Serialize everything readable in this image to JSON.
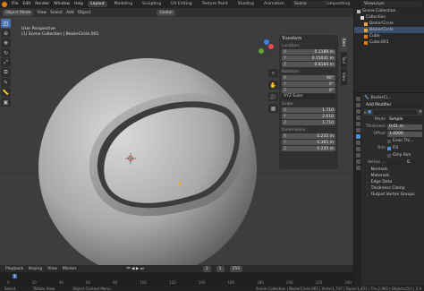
{
  "topbar": {
    "menus": [
      "File",
      "Edit",
      "Render",
      "Window",
      "Help"
    ],
    "workspaces": [
      "Layout",
      "Modeling",
      "Sculpting",
      "UV Editing",
      "Texture Paint",
      "Shading",
      "Animation",
      "Rendering",
      "Compositing"
    ],
    "active_workspace": "Layout",
    "scene": "Scene",
    "view_layer": "ViewLayer"
  },
  "viewport": {
    "mode": "Object Mode",
    "menus": [
      "View",
      "Select",
      "Add",
      "Object"
    ],
    "orientation": "Global",
    "info_line1": "User Perspective",
    "info_line2": "(1) Scene Collection | BezierCircle.001"
  },
  "tools": [
    "cursor",
    "move",
    "rotate",
    "scale",
    "transform",
    "annotate",
    "measure",
    "add-cube"
  ],
  "n_panel": {
    "title": "Transform",
    "location_label": "Location:",
    "location": [
      {
        "k": "X",
        "v": "0.2189 m"
      },
      {
        "k": "Y",
        "v": "0.15031 m"
      },
      {
        "k": "Z",
        "v": "0.8184 m"
      }
    ],
    "rotation_label": "Rotation:",
    "rotation": [
      {
        "k": "X",
        "v": "90°"
      },
      {
        "k": "Y",
        "v": "0°"
      },
      {
        "k": "Z",
        "v": "0°"
      }
    ],
    "rotation_mode": "XYZ Euler",
    "scale_label": "Scale:",
    "scale": [
      {
        "k": "X",
        "v": "1.710"
      },
      {
        "k": "Y",
        "v": "2.610"
      },
      {
        "k": "Z",
        "v": "1.710"
      }
    ],
    "dims_label": "Dimensions:",
    "dims": [
      {
        "k": "X",
        "v": "0.235 m"
      },
      {
        "k": "Y",
        "v": "0.365 m"
      },
      {
        "k": "Z",
        "v": "0.235 m"
      }
    ]
  },
  "side_tabs": [
    "Item",
    "Tool",
    "View"
  ],
  "outliner": {
    "rows": [
      {
        "label": "Scene Collection",
        "indent": 0,
        "sel": false
      },
      {
        "label": "Collection",
        "indent": 1,
        "sel": false
      },
      {
        "label": "BezierCircle",
        "indent": 2,
        "sel": false
      },
      {
        "label": "BezierCircle",
        "indent": 2,
        "sel": true
      },
      {
        "label": "Cube",
        "indent": 2,
        "sel": false
      },
      {
        "label": "Cube.001",
        "indent": 2,
        "sel": false
      }
    ]
  },
  "properties": {
    "object_name": "BezierCi...",
    "add_modifier": "Add Modifier",
    "mode_label": "Mode",
    "mode_value": "Simple",
    "thickness_label": "Thickness",
    "thickness_value": "0.01 m",
    "offset_label": "Offset",
    "offset_value": "1.0000",
    "even_label": "Even Thi...",
    "rim_label": "Rim",
    "fill_label": "Fill",
    "only_rim_label": "Only Rim",
    "vertex_label": "Vertex ...",
    "factor_value": "0.",
    "sections": [
      "Normals",
      "Materials",
      "Edge Data",
      "Thickness Clamp",
      "Output Vertex Groups"
    ]
  },
  "timeline": {
    "menus": [
      "Playback",
      "Keying",
      "View",
      "Marker"
    ],
    "current_frame": "1",
    "start": "1",
    "end": "250",
    "ticks": [
      "0",
      "20",
      "40",
      "60",
      "80",
      "100",
      "120",
      "140",
      "160",
      "180",
      "200",
      "220",
      "240"
    ]
  },
  "status": {
    "items": [
      "Select",
      "Rotate View",
      "Object Context Menu"
    ],
    "right": "Scene Collection | BezierCircle.001 | Verts:1,747 | Faces:1,451 | Tris:2,902 | Objects:0/3 | 2.9"
  }
}
